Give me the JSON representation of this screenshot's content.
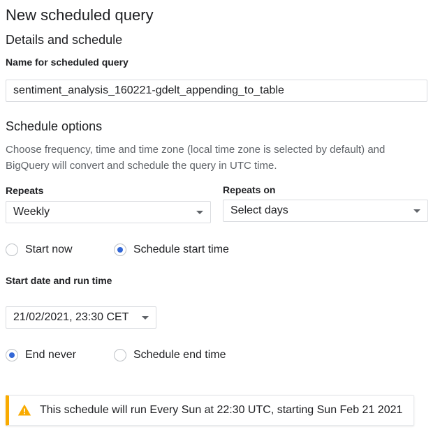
{
  "header": {
    "title": "New scheduled query",
    "section": "Details and schedule"
  },
  "name_field": {
    "label": "Name for scheduled query",
    "value": "sentiment_analysis_160221-gdelt_appending_to_table"
  },
  "schedule_options": {
    "title": "Schedule options",
    "description": "Choose frequency, time and time zone (local time zone is selected by default) and BigQuery will convert and schedule the query in UTC time.",
    "repeats": {
      "label": "Repeats",
      "value": "Weekly"
    },
    "repeats_on": {
      "label": "Repeats on",
      "value": "Select days"
    },
    "start": {
      "options": [
        {
          "label": "Start now",
          "checked": false
        },
        {
          "label": "Schedule start time",
          "checked": true
        }
      ]
    },
    "start_date": {
      "label": "Start date and run time",
      "value": "21/02/2021, 23:30 CET"
    },
    "end": {
      "options": [
        {
          "label": "End never",
          "checked": true
        },
        {
          "label": "Schedule end time",
          "checked": false
        }
      ]
    }
  },
  "notice": {
    "icon": "warning-icon",
    "text": "This schedule will run Every Sun at 22:30 UTC, starting Sun Feb 21 2021",
    "accent_color": "#f9ab00"
  },
  "colors": {
    "radio_checked": "#3367d6",
    "text_primary": "#202124",
    "text_secondary": "#5f6368",
    "border": "#dadce0"
  }
}
